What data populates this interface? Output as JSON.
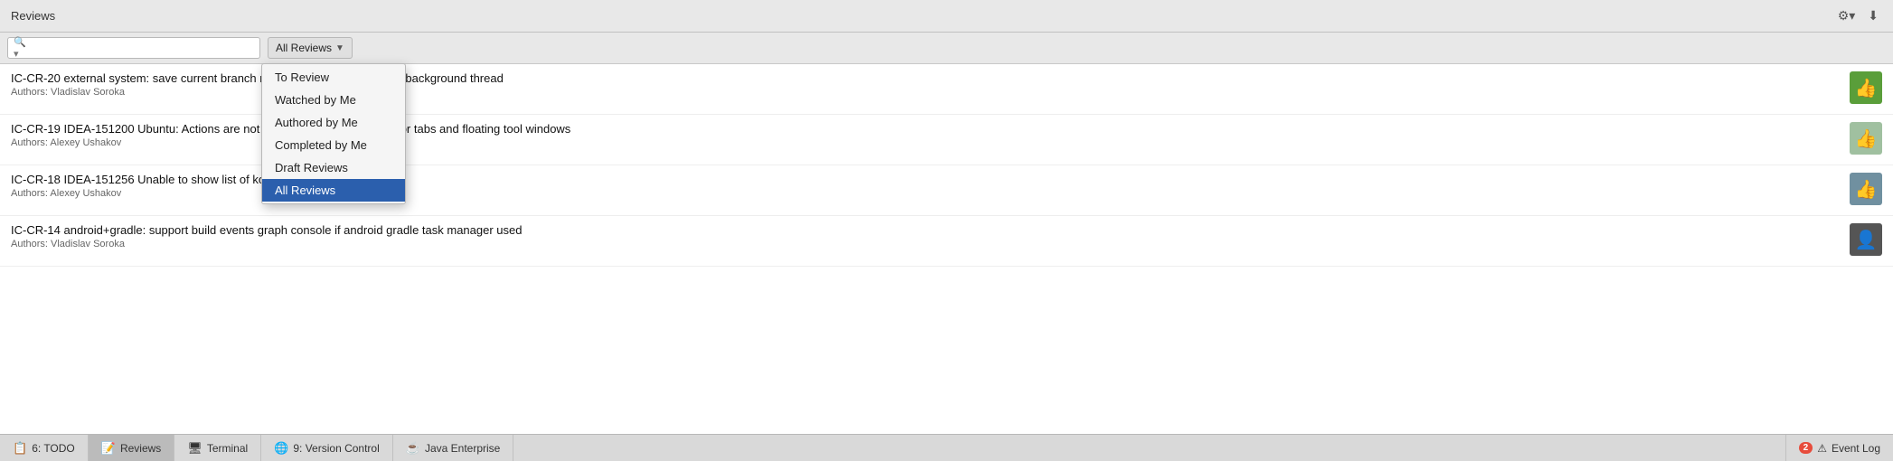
{
  "titleBar": {
    "title": "Reviews",
    "settingsLabel": "⚙",
    "downloadLabel": "⬇"
  },
  "toolbar": {
    "searchPlaceholder": "",
    "searchIconLabel": "🔍",
    "filterButton": "All Reviews",
    "filterArrow": "▼"
  },
  "dropdown": {
    "items": [
      {
        "id": "to-review",
        "label": "To Review",
        "selected": false
      },
      {
        "id": "watched-by-me",
        "label": "Watched by Me",
        "selected": false
      },
      {
        "id": "authored-by-me",
        "label": "Authored by Me",
        "selected": false
      },
      {
        "id": "completed-by-me",
        "label": "Completed by Me",
        "selected": false
      },
      {
        "id": "draft-reviews",
        "label": "Draft Reviews",
        "selected": false
      },
      {
        "id": "all-reviews",
        "label": "All Reviews",
        "selected": true
      }
    ]
  },
  "reviews": [
    {
      "id": "IC-CR-20",
      "title": "IC-CR-20  external system: save current branch name to be accessible as a background thread",
      "authors": "Authors: Vladislav Soroka",
      "avatarType": "green",
      "avatarIcon": "👍"
    },
    {
      "id": "IC-CR-19",
      "title": "IC-CR-19  IDEA-151200 Ubuntu: Actions are not available for detached editor tabs and floating tool windows",
      "authors": "Authors: Alexey Ushakov",
      "avatarType": "teal",
      "avatarIcon": "👍"
    },
    {
      "id": "IC-CR-18",
      "title": "IC-CR-18  IDEA-151256 Unable to show list of kotlin classes in minor IDEs",
      "authors": "Authors: Alexey Ushakov",
      "avatarType": "photo1",
      "avatarIcon": "👍"
    },
    {
      "id": "IC-CR-14",
      "title": "IC-CR-14  android+gradle: support build events graph console if android gradle task manager used",
      "authors": "Authors: Vladislav Soroka",
      "avatarType": "dark",
      "avatarIcon": "👤"
    }
  ],
  "statusBar": {
    "tabs": [
      {
        "id": "todo",
        "icon": "📋",
        "number": "6",
        "label": "TODO"
      },
      {
        "id": "reviews",
        "icon": "📝",
        "label": "Reviews",
        "active": true
      },
      {
        "id": "terminal",
        "icon": "🖥",
        "label": "Terminal"
      },
      {
        "id": "version-control",
        "icon": "🌐",
        "number": "9",
        "label": "Version Control"
      },
      {
        "id": "java-enterprise",
        "icon": "☕",
        "label": "Java Enterprise"
      }
    ],
    "rightTabs": [
      {
        "id": "event-log",
        "icon": "⚠",
        "badge": "2",
        "label": "Event Log"
      }
    ]
  }
}
